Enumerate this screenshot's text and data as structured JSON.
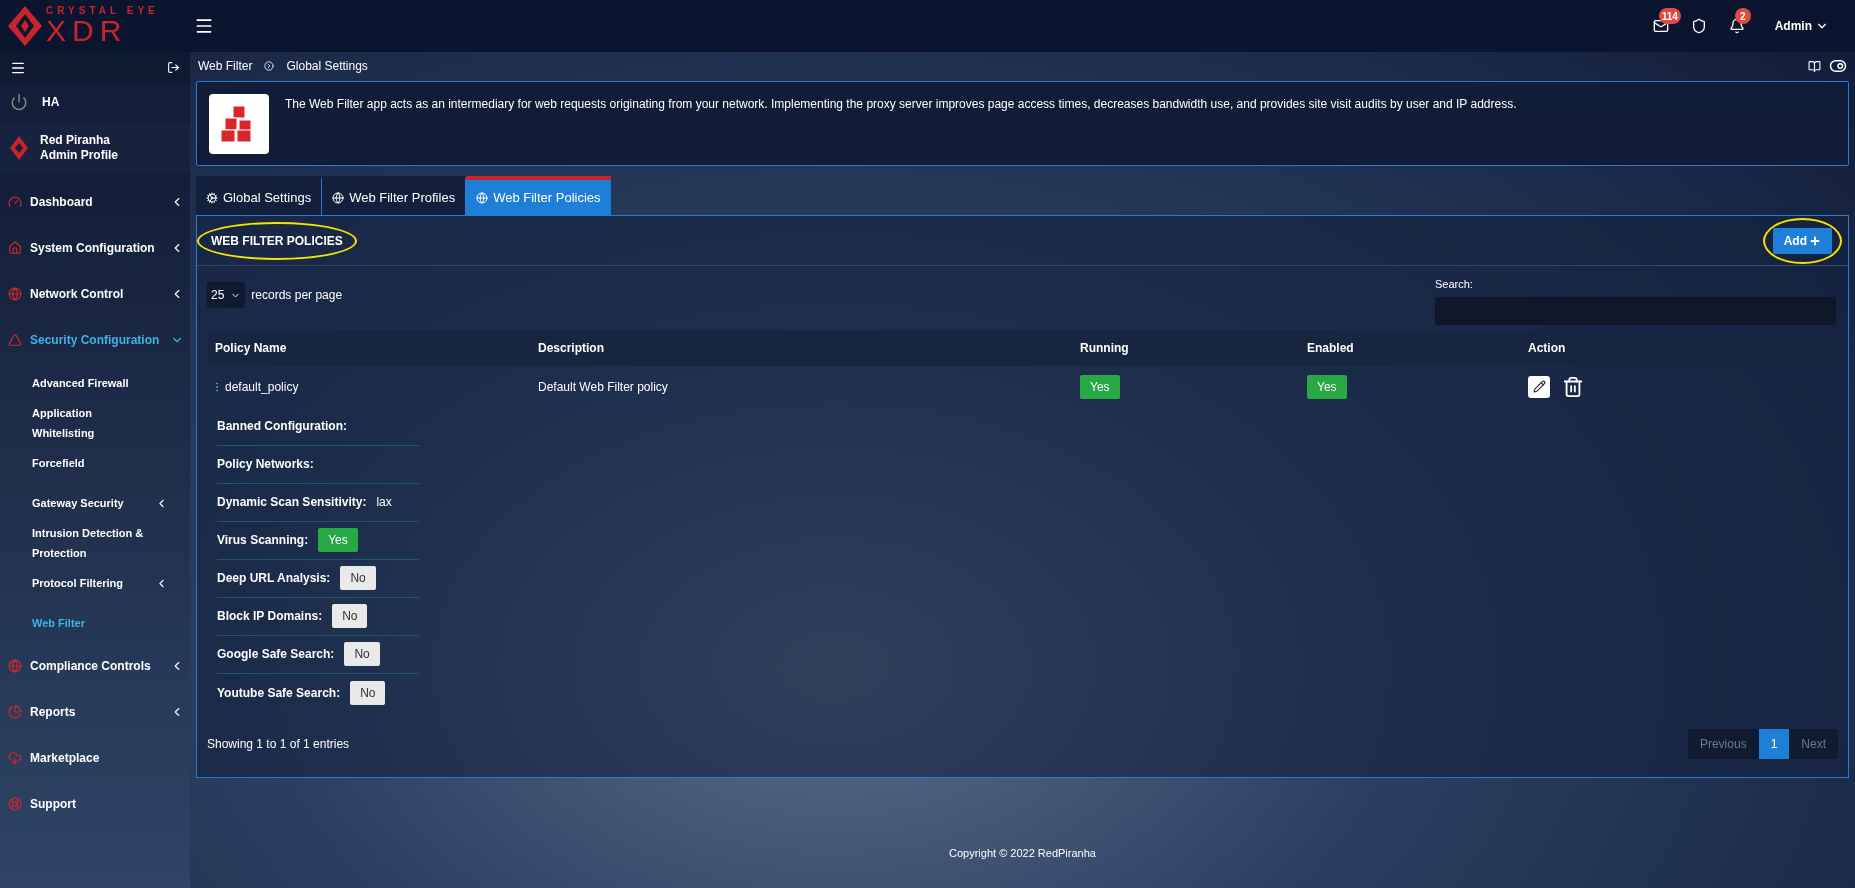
{
  "topbar": {
    "brand_top": "CRYSTAL EYE",
    "brand_main": "XDR",
    "notifications": [
      {
        "kind": "mail",
        "count": "114"
      },
      {
        "kind": "shield"
      },
      {
        "kind": "bell",
        "count": "2"
      }
    ],
    "user": "Admin"
  },
  "sidebar": {
    "ha": "HA",
    "profile": {
      "name": "Red Piranha",
      "role": "Admin Profile"
    },
    "items": [
      {
        "label": "Dashboard",
        "expanded": false,
        "has_children": true,
        "selected": false
      },
      {
        "label": "System Configuration",
        "expanded": false,
        "has_children": true,
        "selected": false
      },
      {
        "label": "Network Control",
        "expanded": false,
        "has_children": true,
        "selected": false
      },
      {
        "label": "Security Configuration",
        "expanded": true,
        "has_children": true,
        "selected": true,
        "children": [
          {
            "label": "Advanced Firewall",
            "has_children": false,
            "selected": false
          },
          {
            "label": "Application Whitelisting",
            "has_children": false,
            "selected": false
          },
          {
            "label": "Forcefield",
            "has_children": false,
            "selected": false
          },
          {
            "label": "Gateway Security",
            "has_children": true,
            "selected": false
          },
          {
            "label": "Intrusion Detection & Protection",
            "has_children": false,
            "selected": false
          },
          {
            "label": "Protocol Filtering",
            "has_children": true,
            "selected": false
          },
          {
            "label": "Web Filter",
            "has_children": false,
            "selected": true
          }
        ]
      },
      {
        "label": "Compliance Controls",
        "expanded": false,
        "has_children": true,
        "selected": false
      },
      {
        "label": "Reports",
        "expanded": false,
        "has_children": true,
        "selected": false
      },
      {
        "label": "Marketplace",
        "expanded": false,
        "has_children": false,
        "selected": false
      },
      {
        "label": "Support",
        "expanded": false,
        "has_children": false,
        "selected": false
      }
    ]
  },
  "breadcrumb": [
    "Web Filter",
    "Global Settings"
  ],
  "info": "The Web Filter app acts as an intermediary for web requests originating from your network. Implementing the proxy server improves page access times, decreases bandwidth use, and provides site visit audits by user and IP address.",
  "tabs": [
    {
      "label": "Global Settings",
      "selected": false
    },
    {
      "label": "Web Filter Profiles",
      "selected": false
    },
    {
      "label": "Web Filter Policies",
      "selected": true
    }
  ],
  "panel": {
    "title": "WEB FILTER POLICIES",
    "title_highlighted": true,
    "add_button": "Add",
    "add_highlighted": true,
    "page_size": "25",
    "page_size_label": "records per page",
    "search_label": "Search:",
    "columns": [
      "Policy Name",
      "Description",
      "Running",
      "Enabled",
      "Action"
    ],
    "rows": [
      {
        "name": "default_policy",
        "description": "Default Web Filter policy",
        "running": {
          "label": "Yes",
          "on": true
        },
        "enabled": {
          "label": "Yes",
          "on": true
        },
        "expanded": true,
        "details": [
          {
            "label": "Banned Configuration:",
            "kind": "text"
          },
          {
            "label": "Policy Networks:",
            "kind": "text"
          },
          {
            "label": "Dynamic Scan Sensitivity:",
            "kind": "text",
            "value": "lax"
          },
          {
            "label": "Virus Scanning:",
            "kind": "badge",
            "value": "Yes",
            "on": true
          },
          {
            "label": "Deep URL Analysis:",
            "kind": "badge",
            "value": "No",
            "on": false
          },
          {
            "label": "Block IP Domains:",
            "kind": "badge",
            "value": "No",
            "on": false
          },
          {
            "label": "Google Safe Search:",
            "kind": "badge",
            "value": "No",
            "on": false
          },
          {
            "label": "Youtube Safe Search:",
            "kind": "badge",
            "value": "No",
            "on": false
          }
        ]
      }
    ],
    "showing": "Showing 1 to 1 of 1 entries",
    "pagination": [
      {
        "label": "Previous",
        "disabled": true,
        "selected": false
      },
      {
        "label": "1",
        "disabled": false,
        "selected": true
      },
      {
        "label": "Next",
        "disabled": true,
        "selected": false
      }
    ]
  },
  "copyright": "Copyright © 2022 RedPiranha"
}
